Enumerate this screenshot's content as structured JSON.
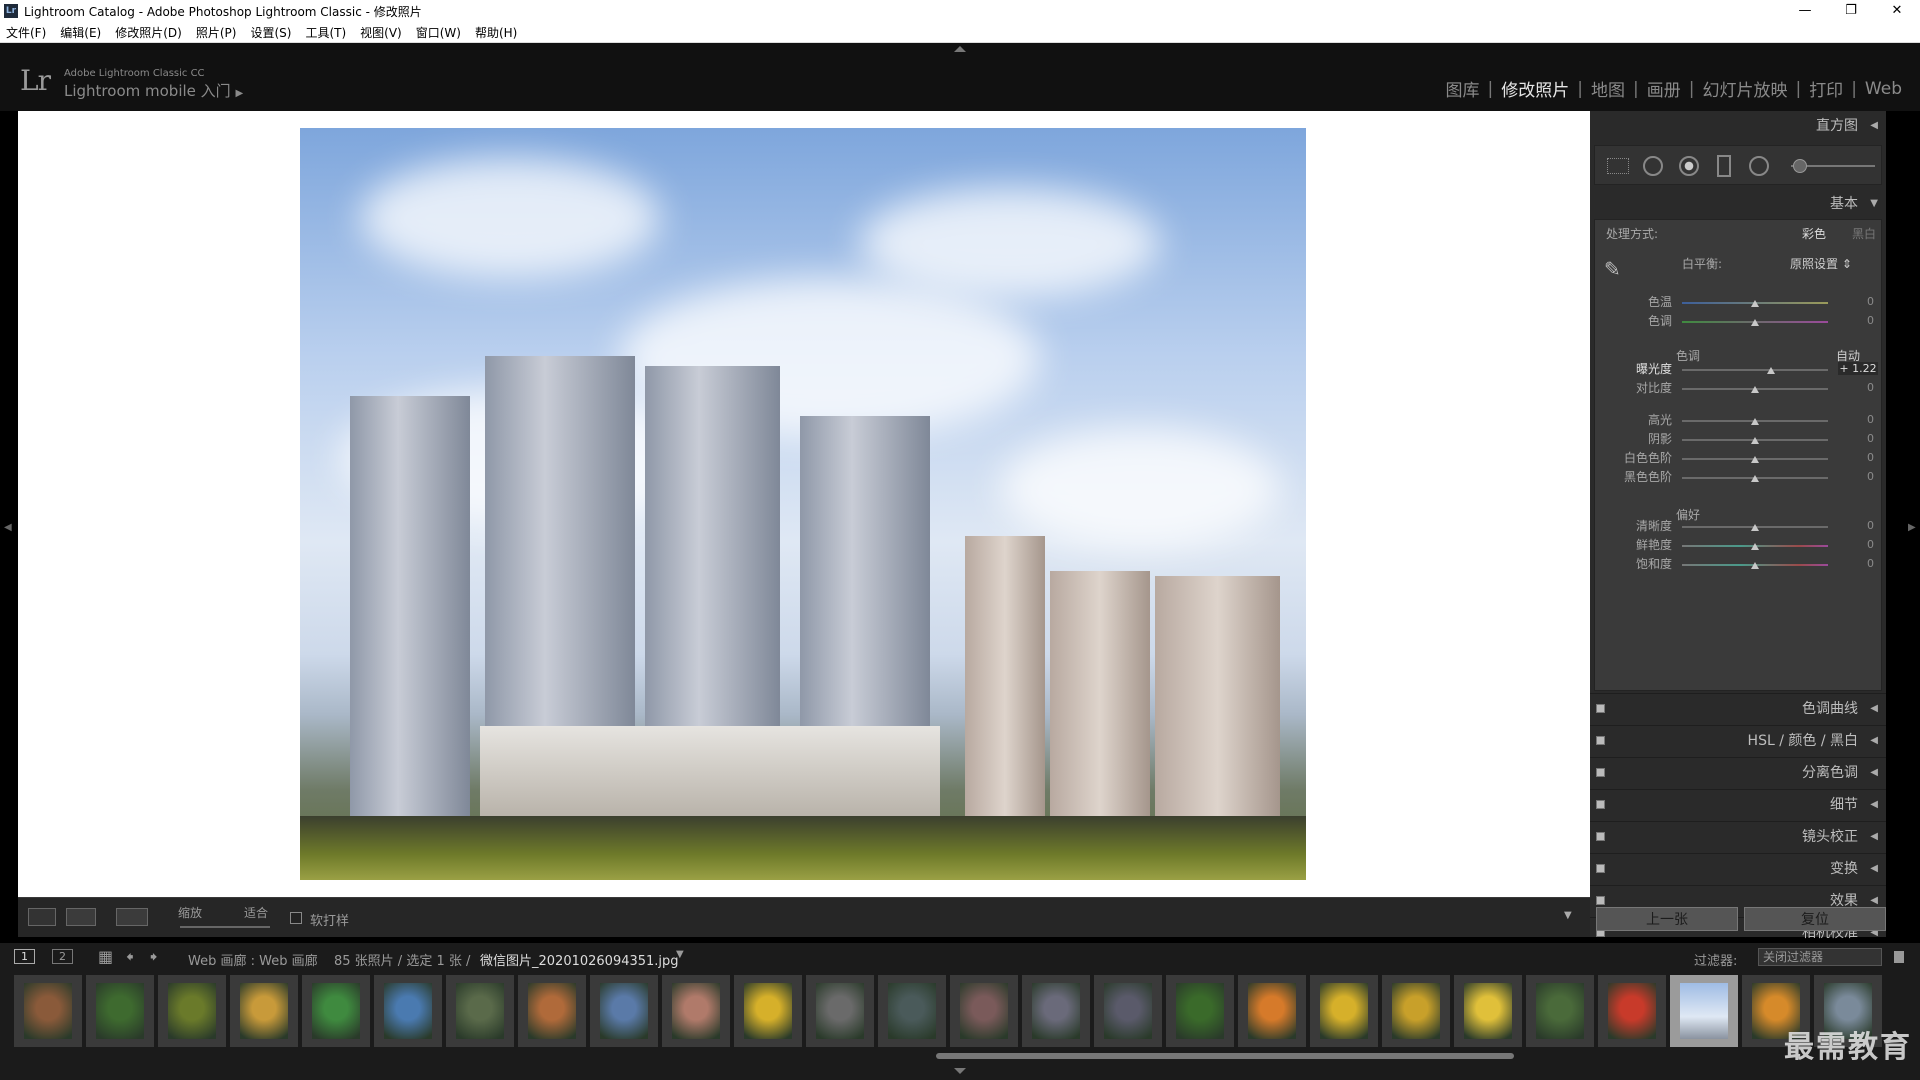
{
  "window": {
    "title": "Lightroom Catalog - Adobe Photoshop Lightroom Classic - 修改照片",
    "app_icon": "Lr"
  },
  "menu": [
    "文件(F)",
    "编辑(E)",
    "修改照片(D)",
    "照片(P)",
    "设置(S)",
    "工具(T)",
    "视图(V)",
    "窗口(W)",
    "帮助(H)"
  ],
  "identity": {
    "logo": "Lr",
    "product": "Adobe Lightroom Classic CC",
    "mobile": "Lightroom mobile 入门"
  },
  "modules": [
    {
      "label": "图库",
      "active": false
    },
    {
      "label": "修改照片",
      "active": true
    },
    {
      "label": "地图",
      "active": false
    },
    {
      "label": "画册",
      "active": false
    },
    {
      "label": "幻灯片放映",
      "active": false
    },
    {
      "label": "打印",
      "active": false
    },
    {
      "label": "Web",
      "active": false
    }
  ],
  "toolbar": {
    "zoom_label": "缩放",
    "fit_label": "适合",
    "soft_proof": "软打样"
  },
  "panel": {
    "histogram": "直方图",
    "basic": "基本",
    "treatment_label": "处理方式:",
    "treatment_color": "彩色",
    "treatment_bw": "黑白",
    "wb_label": "白平衡:",
    "wb_value": "原照设置",
    "tone_label": "色调",
    "auto": "自动",
    "presence_label": "偏好",
    "sliders": [
      {
        "label": "色温",
        "value": "0",
        "pos": 0.5
      },
      {
        "label": "色调",
        "value": "0",
        "pos": 0.5
      },
      {
        "label": "曝光度",
        "value": "+ 1.22",
        "pos": 0.61
      },
      {
        "label": "对比度",
        "value": "0",
        "pos": 0.5
      },
      {
        "label": "高光",
        "value": "0",
        "pos": 0.5
      },
      {
        "label": "阴影",
        "value": "0",
        "pos": 0.5
      },
      {
        "label": "白色色阶",
        "value": "0",
        "pos": 0.5
      },
      {
        "label": "黑色色阶",
        "value": "0",
        "pos": 0.5
      },
      {
        "label": "清晰度",
        "value": "0",
        "pos": 0.5
      },
      {
        "label": "鲜艳度",
        "value": "0",
        "pos": 0.5
      },
      {
        "label": "饱和度",
        "value": "0",
        "pos": 0.5
      }
    ],
    "sections": [
      "色调曲线",
      "HSL / 颜色 / 黑白",
      "分离色调",
      "细节",
      "镜头校正",
      "变换",
      "效果",
      "相机校准"
    ],
    "prev": "上一张",
    "reset": "复位"
  },
  "filmstrip": {
    "pages": [
      "1",
      "2"
    ],
    "breadcrumb": "Web 画廊 : Web 画廊",
    "count": "85 张照片 / 选定 1 张 /",
    "filename": "微信图片_20201026094351.jpg",
    "filter_label": "过滤器:",
    "filter_value": "关闭过滤器",
    "selected_index": 23
  },
  "watermark": "最需教育",
  "colors": {
    "panel_bg": "#2a2a2a",
    "active_module": "#e6e6e6",
    "canvas": "#ffffff"
  }
}
